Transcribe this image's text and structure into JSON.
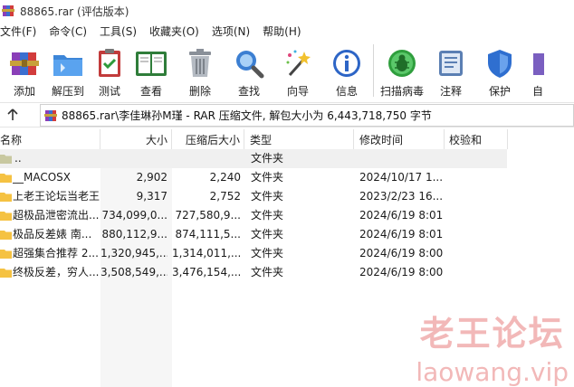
{
  "window": {
    "title": "88865.rar (评估版本)"
  },
  "menu": [
    "文件(F)",
    "命令(C)",
    "工具(S)",
    "收藏夹(O)",
    "选项(N)",
    "帮助(H)"
  ],
  "toolbar": [
    {
      "label": "添加",
      "icon": "add-archive-icon"
    },
    {
      "label": "解压到",
      "icon": "extract-folder-icon"
    },
    {
      "label": "测试",
      "icon": "test-clipboard-icon"
    },
    {
      "label": "查看",
      "icon": "view-book-icon"
    },
    {
      "label": "删除",
      "icon": "trash-icon"
    },
    {
      "label": "查找",
      "icon": "magnifier-icon"
    },
    {
      "label": "向导",
      "icon": "wizard-wand-icon"
    },
    {
      "label": "信息",
      "icon": "info-icon"
    },
    {
      "label": "扫描病毒",
      "icon": "virus-scan-icon"
    },
    {
      "label": "注释",
      "icon": "comment-icon"
    },
    {
      "label": "保护",
      "icon": "shield-icon"
    },
    {
      "label": "自",
      "icon": "sfx-icon"
    }
  ],
  "address": {
    "text": "88865.rar\\李佳琳孙M瑾 - RAR 压缩文件, 解包大小为 6,443,718,750 字节"
  },
  "columns": {
    "name": "名称",
    "size": "大小",
    "packed": "压缩后大小",
    "type": "类型",
    "modified": "修改时间",
    "crc": "校验和"
  },
  "rows": [
    {
      "name": "..",
      "size": "",
      "packed": "",
      "type": "文件夹",
      "modified": ""
    },
    {
      "name": "__MACOSX",
      "size": "2,902",
      "packed": "2,240",
      "type": "文件夹",
      "modified": "2024/10/17 1..."
    },
    {
      "name": "上老王论坛当老王",
      "size": "9,317",
      "packed": "2,752",
      "type": "文件夹",
      "modified": "2023/2/23 16..."
    },
    {
      "name": "超极品泄密流出...",
      "size": "734,099,0...",
      "packed": "727,580,9...",
      "type": "文件夹",
      "modified": "2024/6/19 8:01"
    },
    {
      "name": "极品反差婊 南...",
      "size": "880,112,9...",
      "packed": "874,111,5...",
      "type": "文件夹",
      "modified": "2024/6/19 8:01"
    },
    {
      "name": "超强集合推荐 2...",
      "size": "1,320,945,...",
      "packed": "1,314,011,...",
      "type": "文件夹",
      "modified": "2024/6/19 8:00"
    },
    {
      "name": "终极反差，穷人...",
      "size": "3,508,549,...",
      "packed": "3,476,154,...",
      "type": "文件夹",
      "modified": "2024/6/19 8:00"
    }
  ],
  "watermark": {
    "cn": "老王论坛",
    "en": "laowang.vip"
  },
  "colors": {
    "folder": "#f5c242",
    "selected_row": "#f0f0f0",
    "watermark": "#f2b8b8",
    "accent": "#2a6fd6"
  }
}
